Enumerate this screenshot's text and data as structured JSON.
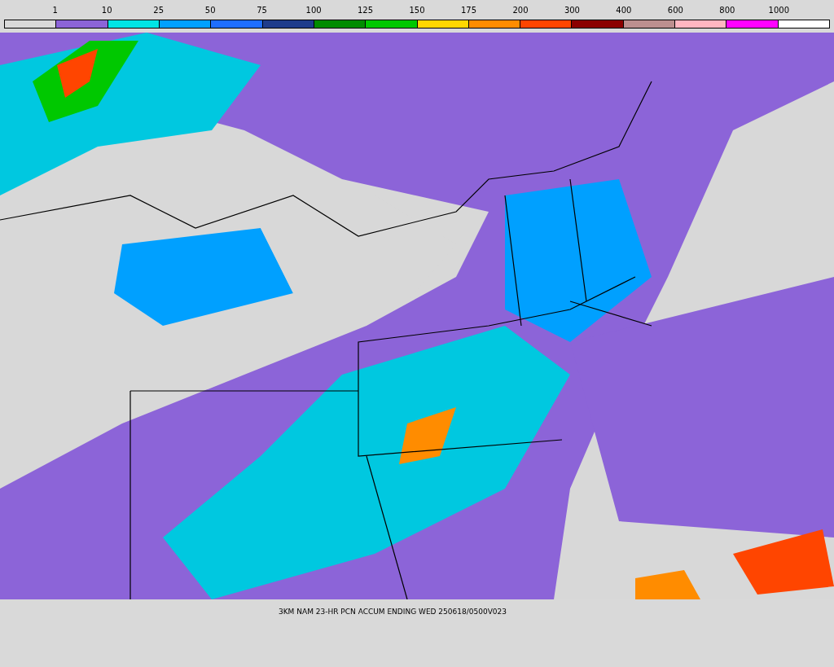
{
  "legend": {
    "labels": [
      "1",
      "10",
      "25",
      "50",
      "75",
      "100",
      "125",
      "150",
      "175",
      "200",
      "300",
      "400",
      "600",
      "800",
      "1000"
    ],
    "segments": [
      {
        "color": "#d9d9d9"
      },
      {
        "color": "#8c64d8"
      },
      {
        "color": "#00e5e5"
      },
      {
        "color": "#00a0ff"
      },
      {
        "color": "#1e6eff"
      },
      {
        "color": "#1e3c8c"
      },
      {
        "color": "#008c00"
      },
      {
        "color": "#00c800"
      },
      {
        "color": "#ffd700"
      },
      {
        "color": "#ff8c00"
      },
      {
        "color": "#ff4500"
      },
      {
        "color": "#8b0000"
      },
      {
        "color": "#bc8f8f"
      },
      {
        "color": "#ffb6c1"
      },
      {
        "color": "#ff00ff"
      },
      {
        "color": "#ffffff"
      }
    ]
  },
  "caption": "3KM NAM 23-HR PCN ACCUM ENDING WED 250618/0500V023"
}
